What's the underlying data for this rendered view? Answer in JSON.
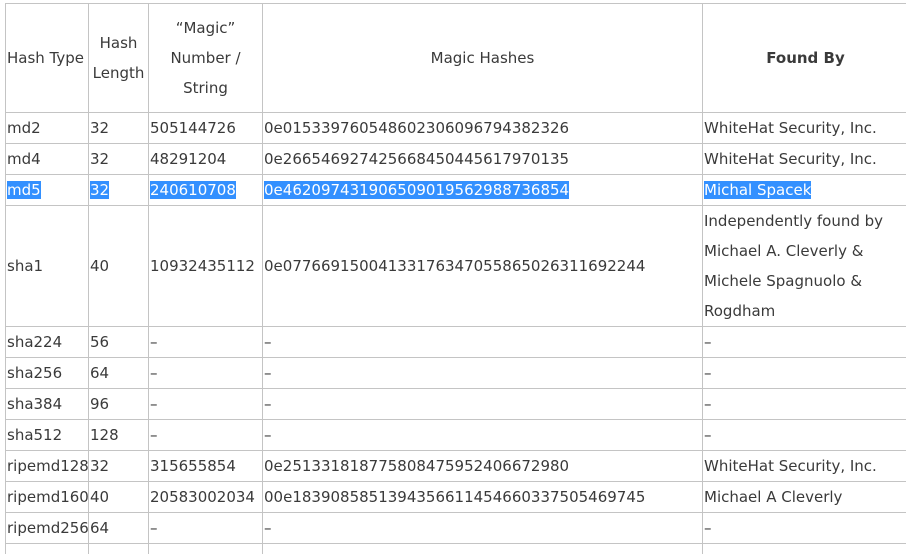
{
  "table": {
    "headers": {
      "hash_type": "Hash Type",
      "hash_length": [
        "Hash",
        "Length"
      ],
      "magic": [
        "“Magic”",
        "Number /",
        "String"
      ],
      "magic_hashes": "Magic Hashes",
      "found_by": "Found By"
    },
    "rows": [
      {
        "type": "md2",
        "length": "32",
        "magic": "505144726",
        "hash": "0e015339760548602306096794382326",
        "found_by": [
          "WhiteHat Security, Inc."
        ]
      },
      {
        "type": "md4",
        "length": "32",
        "magic": "48291204",
        "hash": "0e266546927425668450445617970135",
        "found_by": [
          "WhiteHat Security, Inc."
        ]
      },
      {
        "type": "md5",
        "length": "32",
        "magic": "240610708",
        "hash": "0e462097431906509019562988736854",
        "found_by": [
          "Michal Spacek"
        ],
        "selected": true
      },
      {
        "type": "sha1",
        "length": "40",
        "magic": "10932435112",
        "hash": "0e07766915004133176347055865026311692244",
        "found_by": [
          "Independently found by",
          "Michael A. Cleverly &",
          "Michele Spagnuolo &",
          "Rogdham"
        ]
      },
      {
        "type": "sha224",
        "length": "56",
        "magic": "–",
        "hash": "–",
        "found_by": [
          "–"
        ]
      },
      {
        "type": "sha256",
        "length": "64",
        "magic": "–",
        "hash": "–",
        "found_by": [
          "–"
        ]
      },
      {
        "type": "sha384",
        "length": "96",
        "magic": "–",
        "hash": "–",
        "found_by": [
          "–"
        ]
      },
      {
        "type": "sha512",
        "length": "128",
        "magic": "–",
        "hash": "–",
        "found_by": [
          "–"
        ]
      },
      {
        "type": "ripemd128",
        "length": "32",
        "magic": "315655854",
        "hash": "0e251331818775808475952406672980",
        "found_by": [
          "WhiteHat Security, Inc."
        ]
      },
      {
        "type": "ripemd160",
        "length": "40",
        "magic": "20583002034",
        "hash": "00e1839085851394356611454660337505469745",
        "found_by": [
          "Michael A Cleverly"
        ]
      },
      {
        "type": "ripemd256",
        "length": "64",
        "magic": "–",
        "hash": "–",
        "found_by": [
          "–"
        ]
      }
    ]
  },
  "colors": {
    "selection": "#3390ff",
    "selection_text": "#ffffff",
    "border": "#c4c4c4",
    "text": "#3a3a3a"
  }
}
